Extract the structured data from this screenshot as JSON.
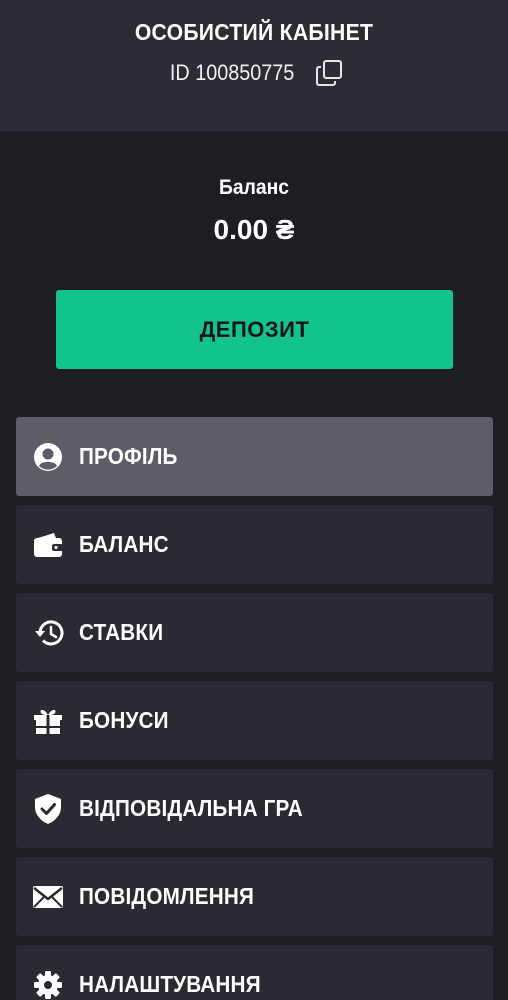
{
  "header": {
    "title": "ОСОБИСТИЙ КАБІНЕТ",
    "id_text": "ID 100850775",
    "copy_icon": "copy-icon"
  },
  "balance": {
    "label": "Баланс",
    "value": "0.00 ₴"
  },
  "deposit_button": {
    "label": "ДЕПОЗИТ",
    "color": "#12c48b"
  },
  "menu": {
    "items": [
      {
        "label": "ПРОФІЛЬ",
        "icon": "user-icon",
        "active": true
      },
      {
        "label": "БАЛАНС",
        "icon": "wallet-icon",
        "active": false
      },
      {
        "label": "СТАВКИ",
        "icon": "history-icon",
        "active": false
      },
      {
        "label": "БОНУСИ",
        "icon": "gift-icon",
        "active": false
      },
      {
        "label": "ВІДПОВІДАЛЬНА ГРА",
        "icon": "shield-check-icon",
        "active": false
      },
      {
        "label": "ПОВІДОМЛЕННЯ",
        "icon": "envelope-icon",
        "active": false
      },
      {
        "label": "НАЛАШТУВАННЯ",
        "icon": "gear-icon",
        "active": false
      }
    ]
  },
  "colors": {
    "background": "#1d1e24",
    "header_background": "#2b2c34",
    "menu_item": "#2a2b32",
    "menu_item_active": "#5c5d66",
    "accent": "#12c48b"
  }
}
